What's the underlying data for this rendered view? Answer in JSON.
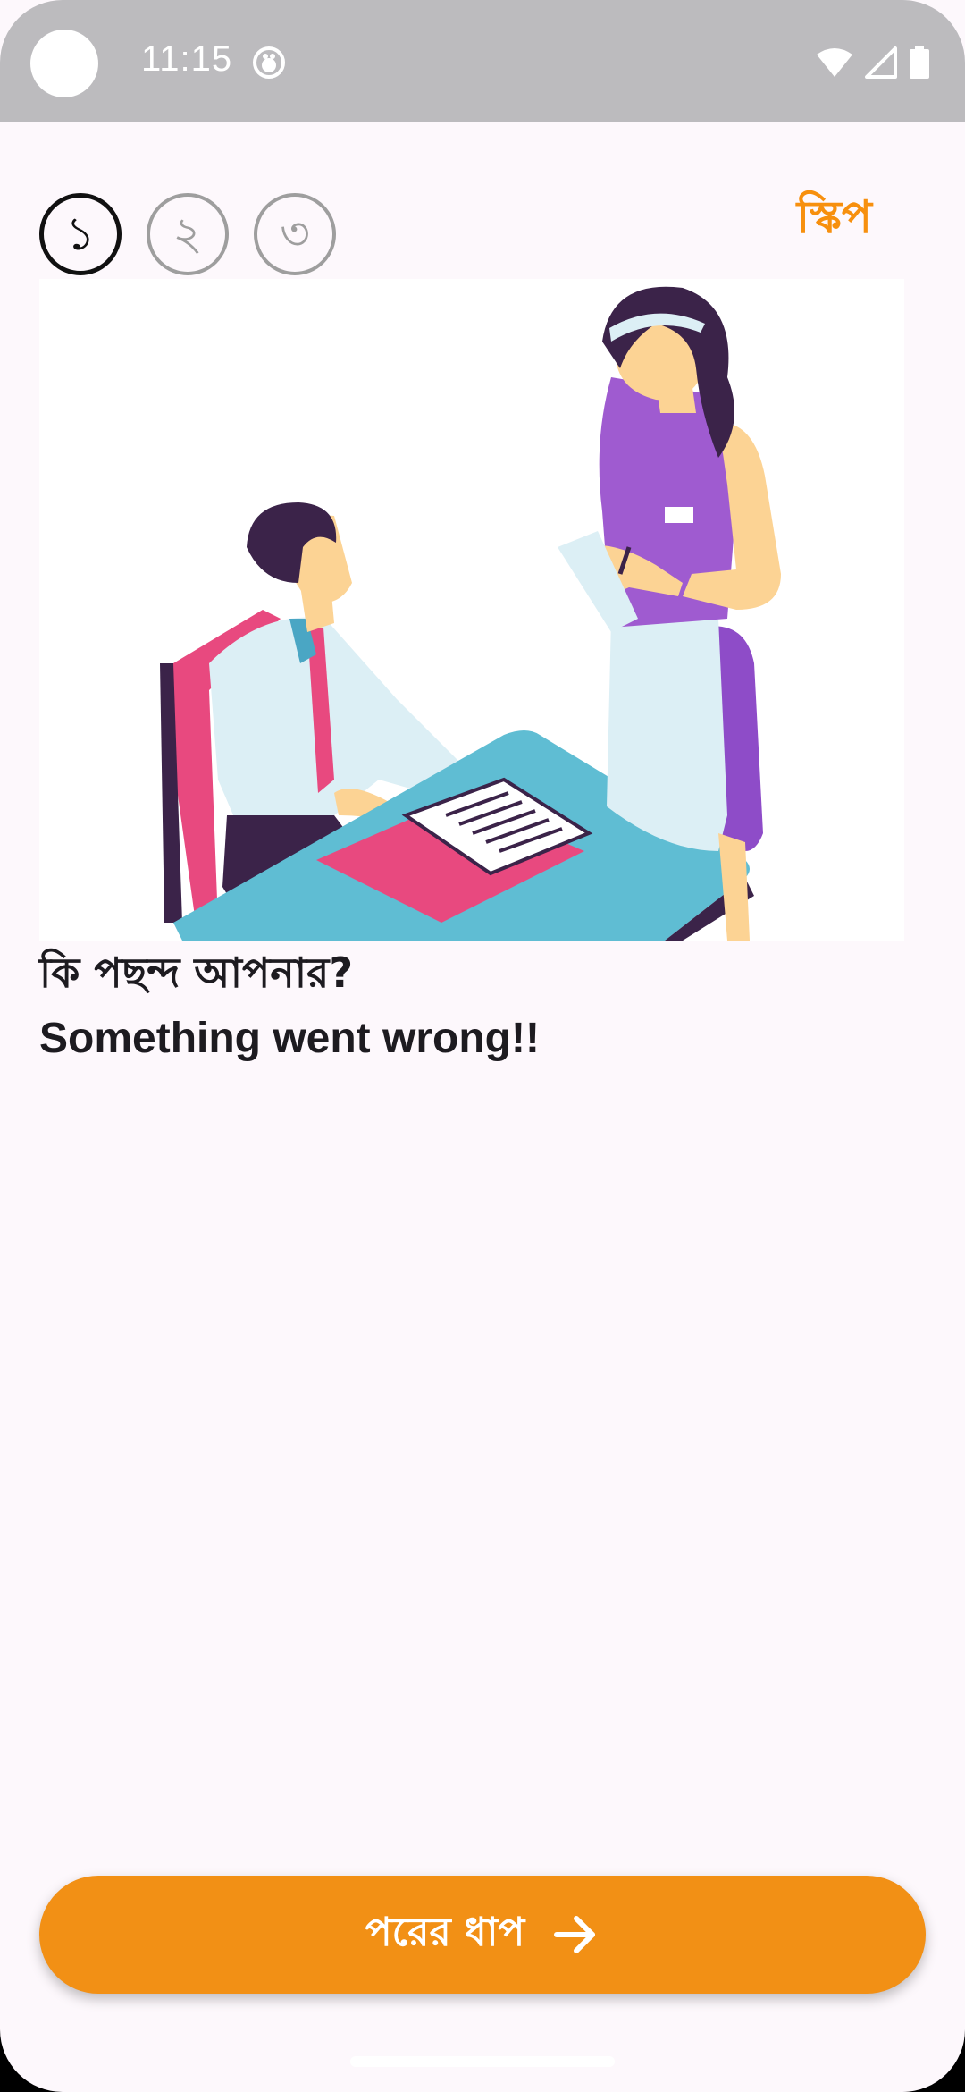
{
  "status_bar": {
    "time": "11:15",
    "icons": [
      "notification-face-icon",
      "wifi-icon",
      "signal-icon",
      "battery-icon"
    ]
  },
  "steps": {
    "items": [
      "১",
      "২",
      "৩"
    ],
    "active_index": 0
  },
  "skip_label": "স্কিপ",
  "illustration_icon": "waitress-taking-order-illustration",
  "question": "কি পছন্দ আপনার?",
  "error_message": "Something went wrong!!",
  "next_button": {
    "label": "পরের ধাপ",
    "icon": "arrow-right-icon"
  },
  "colors": {
    "accent": "#f29015",
    "skip": "#f7900e",
    "background": "#fdf8fc",
    "status_bar": "#bcbbbe"
  }
}
